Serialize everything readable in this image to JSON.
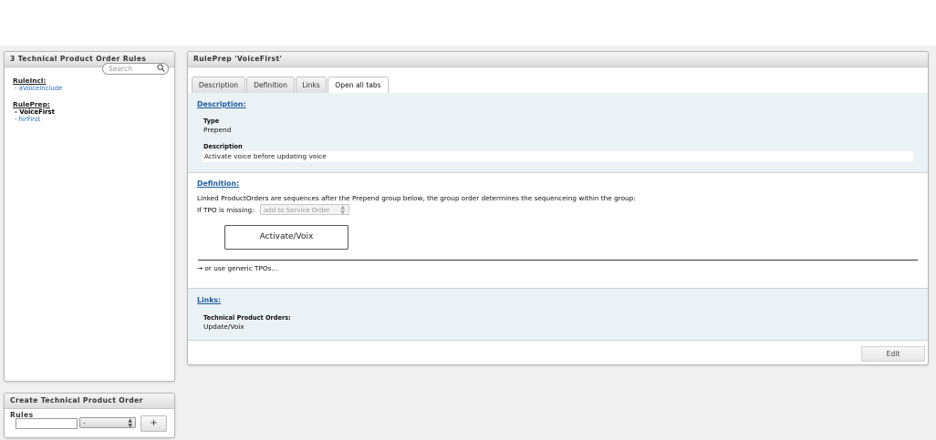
{
  "left_panel": {
    "title": "3 Technical Product Order Rules",
    "search_placeholder": "Search",
    "groups": [
      {
        "title": "RuleIncl:",
        "items": [
          {
            "label": "- aVoiceInclude"
          }
        ]
      },
      {
        "title": "RulePrep:",
        "items": [
          {
            "label": "- VoiceFirst"
          },
          {
            "label": "- hirFirst"
          }
        ]
      }
    ]
  },
  "create_panel": {
    "title": "Create Technical Product Order Rules",
    "select_value": "-",
    "add_label": "+"
  },
  "main_panel": {
    "title": "RulePrep 'VoiceFirst'",
    "tabs": [
      "Description",
      "Definition",
      "Links",
      "Open all tabs"
    ],
    "description": {
      "title": "Description:",
      "type_label": "Type",
      "type_value": "Prepend",
      "desc_label": "Description",
      "desc_value": "Activate voice before updating voice"
    },
    "definition": {
      "title": "Definition:",
      "text": "Linked ProductOrders are sequences after the Prepend group below, the group order determines the sequenceing within the group:",
      "missing_label": "If TPO is missing:",
      "missing_select": "add to Service Order",
      "order_item": "Activate/Voix",
      "generic_link": "→ or use generic TPOs..."
    },
    "links": {
      "title": "Links:",
      "tpo_label": "Technical Product Orders:",
      "tpo_value": "Update/Voix"
    },
    "edit_label": "Edit"
  }
}
